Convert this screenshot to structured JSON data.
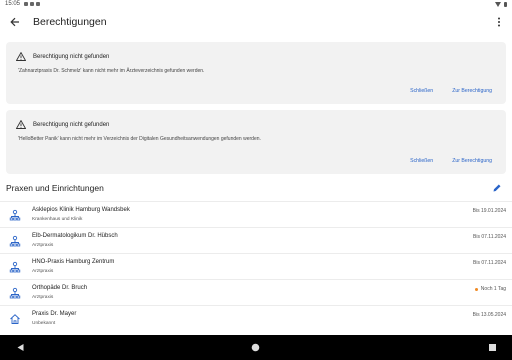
{
  "status": {
    "time": "15:05"
  },
  "app_bar": {
    "title": "Berechtigungen"
  },
  "alerts": [
    {
      "title": "Berechtigung nicht gefunden",
      "message": "'Zahnarztpraxis Dr. Schmelz' kann nicht mehr im Ärzteverzeichnis gefunden werden.",
      "dismiss_label": "Schließen",
      "go_label": "Zur Berechtigung"
    },
    {
      "title": "Berechtigung nicht gefunden",
      "message": "'HelloBetter Panik' kann nicht mehr im Verzeichnis der Digitalen Gesundheitsanwendungen gefunden werden.",
      "dismiss_label": "Schließen",
      "go_label": "Zur Berechtigung"
    }
  ],
  "section": {
    "title": "Praxen und Einrichtungen"
  },
  "entries": [
    {
      "name": "Asklepios Klinik Hamburg Wandsbek",
      "type": "Krankenhaus und Klinik",
      "date": "Bis 19.01.2024",
      "icon": "person-network-icon",
      "pending": false
    },
    {
      "name": "Elb-Dermatologikum Dr. Hübsch",
      "type": "Arztpraxis",
      "date": "Bis 07.11.2024",
      "icon": "person-network-icon",
      "pending": false
    },
    {
      "name": "HNO-Praxis Hamburg Zentrum",
      "type": "Arztpraxis",
      "date": "Bis 07.11.2024",
      "icon": "person-network-icon",
      "pending": false
    },
    {
      "name": "Orthopäde Dr. Bruch",
      "type": "Arztpraxis",
      "date": "Noch 1 Tag",
      "icon": "person-network-icon",
      "pending": true
    },
    {
      "name": "Praxis Dr. Mayer",
      "type": "Unbekannt",
      "date": "Bis 13.05.2024",
      "icon": "home-icon",
      "pending": false
    }
  ],
  "colors": {
    "accent": "#2a64c8",
    "warning_dot": "#f08a24",
    "card_bg": "#f2f2f2"
  }
}
